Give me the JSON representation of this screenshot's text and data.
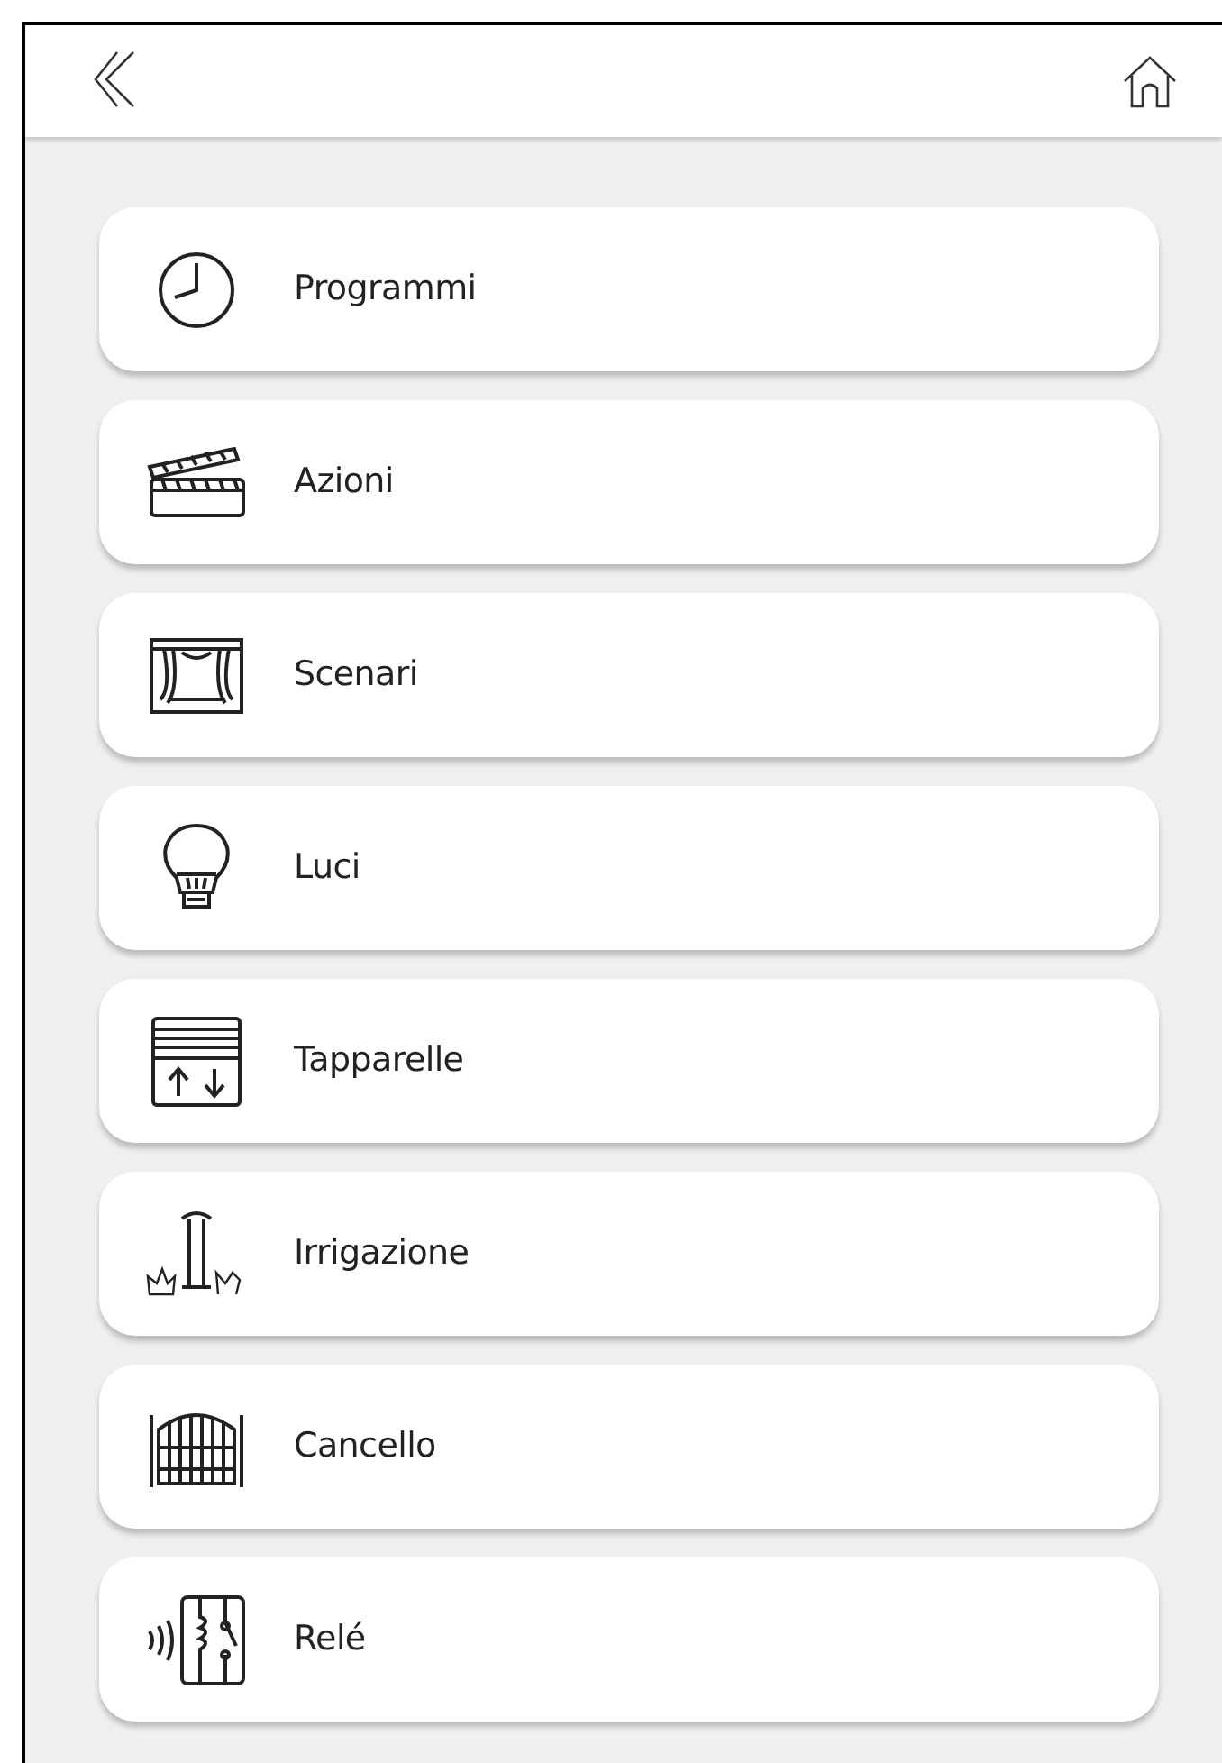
{
  "menu": [
    {
      "label": "Programmi",
      "kind": "clock"
    },
    {
      "label": "Azioni",
      "kind": "clapper"
    },
    {
      "label": "Scenari",
      "kind": "curtain"
    },
    {
      "label": "Luci",
      "kind": "bulb"
    },
    {
      "label": "Tapparelle",
      "kind": "shutter"
    },
    {
      "label": "Irrigazione",
      "kind": "sprinkler"
    },
    {
      "label": "Cancello",
      "kind": "gate"
    },
    {
      "label": "Relé",
      "kind": "relay"
    }
  ]
}
